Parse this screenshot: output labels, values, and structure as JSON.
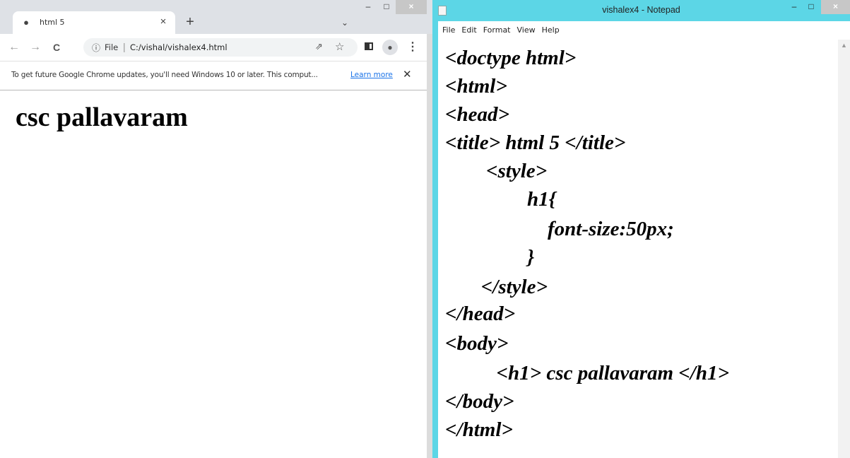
{
  "chrome": {
    "tab": {
      "favicon": "globe-icon",
      "title": "html 5",
      "close_glyph": "×"
    },
    "new_tab_glyph": "+",
    "tab_search_glyph": "⌄",
    "window_controls": {
      "minimize": "–",
      "maximize": "□",
      "close": "×"
    },
    "toolbar": {
      "back_glyph": "←",
      "forward_glyph": "→",
      "reload_glyph": "C",
      "info_glyph": "ⓘ",
      "scheme": "File",
      "separator": "|",
      "url": "C:/vishal/vishalex4.html",
      "share_glyph": "⇗",
      "star_glyph": "☆",
      "profile_glyph": "●",
      "menu_glyph": "⋮"
    },
    "infobar": {
      "message": "To get future Google Chrome updates, you'll need Windows 10 or later. This comput...",
      "link": "Learn more",
      "dismiss_glyph": "✕"
    },
    "page": {
      "heading": "csc pallavaram"
    }
  },
  "notepad": {
    "title": "vishalex4 - Notepad",
    "window_controls": {
      "minimize": "–",
      "maximize": "□",
      "close": "×"
    },
    "menu": [
      "File",
      "Edit",
      "Format",
      "View",
      "Help"
    ],
    "lines": [
      "<doctype html>",
      "<html>",
      "<head>",
      "<title> html 5 </title>",
      "        <style>",
      "                h1{",
      "                    font-size:50px;",
      "                }",
      "       </style>",
      "</head>",
      "<body>",
      "          <h1> csc pallavaram </h1>",
      "</body>",
      "</html>"
    ],
    "scroll_up_glyph": "▲"
  }
}
